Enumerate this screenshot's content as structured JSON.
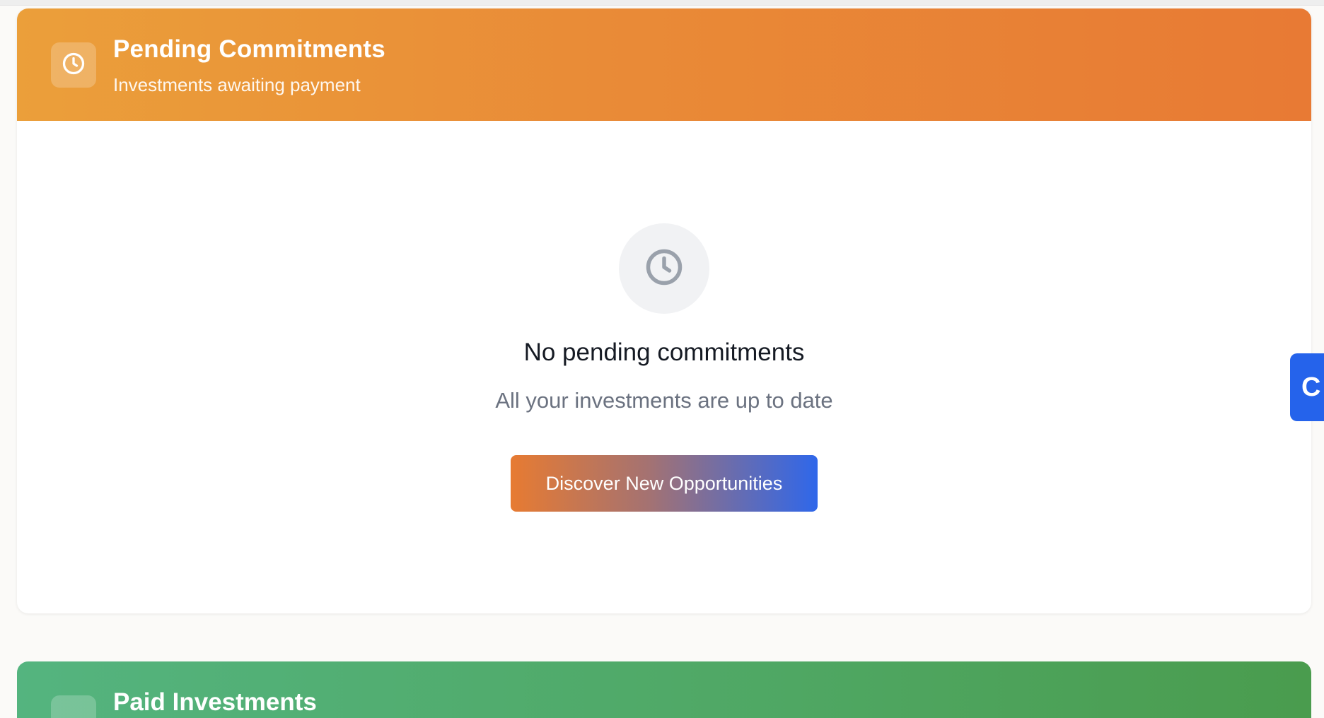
{
  "pending": {
    "title": "Pending Commitments",
    "subtitle": "Investments awaiting payment",
    "header_icon": "clock-icon",
    "empty_icon": "clock-icon",
    "empty_title": "No pending commitments",
    "empty_subtitle": "All your investments are up to date",
    "cta_label": "Discover New Opportunities"
  },
  "paid": {
    "title": "Paid Investments",
    "header_icon": "check-icon"
  },
  "side_widget": {
    "label": "C"
  },
  "colors": {
    "pending_header_start": "#eb9f3a",
    "pending_header_end": "#e87a34",
    "paid_header_start": "#54b47f",
    "paid_header_end": "#4a9c4e",
    "cta_start": "#e77b32",
    "cta_end": "#2f67ea",
    "side_widget": "#2563eb"
  }
}
